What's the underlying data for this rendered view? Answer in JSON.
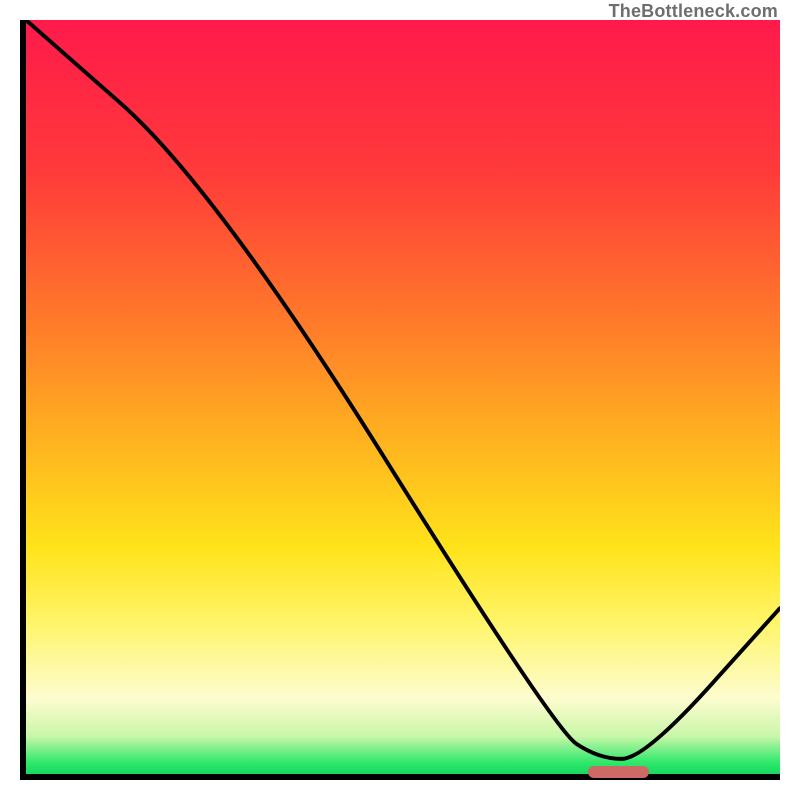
{
  "watermark": "TheBottleneck.com",
  "chart_data": {
    "type": "line",
    "title": "",
    "xlabel": "",
    "ylabel": "",
    "xlim": [
      0,
      100
    ],
    "ylim": [
      0,
      100
    ],
    "grid": false,
    "series": [
      {
        "name": "curve",
        "x": [
          0,
          25,
          70,
          76,
          82,
          100
        ],
        "values": [
          100,
          78,
          6,
          2,
          2,
          22
        ]
      }
    ],
    "optimal_marker": {
      "x_start": 74,
      "x_end": 82,
      "y": 1
    },
    "gradient_stops": [
      {
        "pos": 0.0,
        "color": "#ff1a4b"
      },
      {
        "pos": 0.2,
        "color": "#ff3a3a"
      },
      {
        "pos": 0.4,
        "color": "#ff7a2a"
      },
      {
        "pos": 0.55,
        "color": "#ffb020"
      },
      {
        "pos": 0.7,
        "color": "#ffe31a"
      },
      {
        "pos": 0.8,
        "color": "#fff56a"
      },
      {
        "pos": 0.9,
        "color": "#fdfccf"
      },
      {
        "pos": 0.95,
        "color": "#c8f7a8"
      },
      {
        "pos": 0.985,
        "color": "#2ee86b"
      },
      {
        "pos": 1.0,
        "color": "#17d85f"
      }
    ]
  }
}
